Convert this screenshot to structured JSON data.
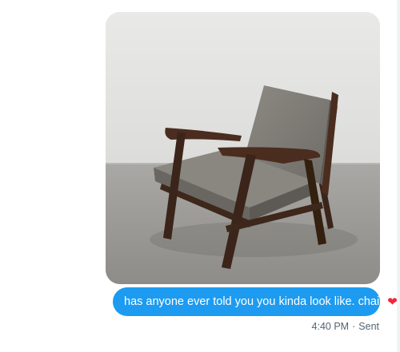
{
  "message": {
    "text": "has anyone ever told you you kinda look like. chaie",
    "heart_glyph": "❤",
    "bubble_color": "#1d9bf0"
  },
  "meta": {
    "time": "4:40 PM",
    "separator": "·",
    "status": "Sent"
  },
  "image": {
    "subject": "armchair-photo"
  }
}
